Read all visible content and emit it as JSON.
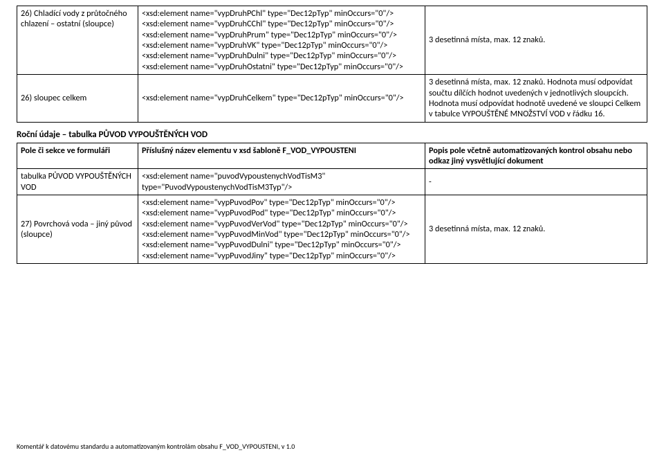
{
  "table1": {
    "rows": [
      {
        "label": "26) Chladící vody z průtočného chlazení – ostatní (sloupce)",
        "xsd": "<xsd:element name=\"vypDruhPChl\" type=\"Dec12pTyp\" minOccurs=\"0\"/>\n<xsd:element name=\"vypDruhCChl\" type=\"Dec12pTyp\" minOccurs=\"0\"/>\n<xsd:element name=\"vypDruhPrum\" type=\"Dec12pTyp\" minOccurs=\"0\"/>\n<xsd:element name=\"vypDruhVK\" type=\"Dec12pTyp\" minOccurs=\"0\"/>\n<xsd:element name=\"vypDruhDulni\" type=\"Dec12pTyp\" minOccurs=\"0\"/>\n<xsd:element name=\"vypDruhOstatni\" type=\"Dec12pTyp\" minOccurs=\"0\"/>",
        "desc": "3 desetinná místa, max. 12 znaků."
      },
      {
        "label": "26) sloupec celkem",
        "xsd": "<xsd:element name=\"vypDruhCelkem\" type=\"Dec12pTyp\" minOccurs=\"0\"/>",
        "desc": "3 desetinná místa, max. 12 znaků. Hodnota musí odpovídat součtu dílčích hodnot uvedených v jednotlivých sloupcích. Hodnota musí odpovídat hodnotě uvedené ve sloupci Celkem v tabulce VYPOUŠTĚNÉ MNOŽSTVÍ VOD v řádku 16."
      }
    ]
  },
  "section2_heading": "Roční údaje – tabulka PŮVOD VYPOUŠTĚNÝCH VOD",
  "table2": {
    "headers": {
      "c1": "Pole či sekce ve formuláři",
      "c2": "Příslušný název elementu v xsd šabloně F_VOD_VYPOUSTENI",
      "c3": "Popis pole včetně automatizovaných kontrol obsahu nebo odkaz jiný vysvětlující dokument"
    },
    "rows": [
      {
        "label": "tabulka PŮVOD VYPOUŠTĚNÝCH VOD",
        "xsd": "<xsd:element name=\"puvodVypoustenychVodTisM3\" type=\"PuvodVypoustenychVodTisM3Typ\"/>",
        "desc": "-"
      },
      {
        "label": "27) Povrchová voda – jiný původ (sloupce)",
        "xsd": "<xsd:element name=\"vypPuvodPov\" type=\"Dec12pTyp\" minOccurs=\"0\"/>\n<xsd:element name=\"vypPuvodPod\" type=\"Dec12pTyp\" minOccurs=\"0\"/>\n<xsd:element name=\"vypPuvodVerVod\" type=\"Dec12pTyp\" minOccurs=\"0\"/>\n<xsd:element name=\"vypPuvodMinVod\" type=\"Dec12pTyp\" minOccurs=\"0\"/>\n<xsd:element name=\"vypPuvodDulni\" type=\"Dec12pTyp\" minOccurs=\"0\"/>\n<xsd:element name=\"vypPuvodJiny\" type=\"Dec12pTyp\" minOccurs=\"0\"/>",
        "desc": "3 desetinná místa, max. 12 znaků."
      }
    ]
  },
  "footer": "Komentář k datovému standardu a automatizovaným kontrolám obsahu F_VOD_VYPOUSTENI, v 1.0"
}
